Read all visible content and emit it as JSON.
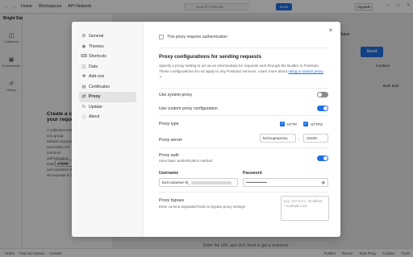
{
  "topbar": {
    "nav_home": "Home",
    "nav_workspaces": "Workspaces",
    "nav_api_network": "API Network",
    "search_placeholder": "Search Postman",
    "invite_label": "Invite",
    "upgrade_label": "Upgrade"
  },
  "workspace": {
    "name": "Bright Data"
  },
  "leftbar": {
    "items": [
      {
        "label": "Collections",
        "icon": "folder-icon"
      },
      {
        "label": "Environments",
        "icon": "environment-icon"
      },
      {
        "label": "History",
        "icon": "history-icon"
      }
    ]
  },
  "sidepanel": {
    "title": "Create a collection for your requests",
    "description": "A collection lets you group related requests and easily set common authorization, tests, scripts, and variables for all requests in it.",
    "create_button": "Create"
  },
  "request": {
    "send_label": "Send",
    "save_label": "Save",
    "cookies_label": "Cookies",
    "bulk_edit_label": "Bulk Edit",
    "hint": "Enter the URL and click Send to get a response"
  },
  "statusbar": {
    "online": "Online",
    "find_replace": "Find and replace",
    "console": "Console",
    "postbot": "Postbot",
    "runner": "Runner",
    "start_proxy": "Start Proxy",
    "cookies": "Cookies",
    "trash": "Trash"
  },
  "settings": {
    "nav": [
      {
        "label": "General",
        "icon": "gear-icon",
        "active": false
      },
      {
        "label": "Themes",
        "icon": "palette-icon",
        "active": false
      },
      {
        "label": "Shortcuts",
        "icon": "keyboard-icon",
        "active": false
      },
      {
        "label": "Data",
        "icon": "database-icon",
        "active": false
      },
      {
        "label": "Add-ons",
        "icon": "puzzle-icon",
        "active": false
      },
      {
        "label": "Certificates",
        "icon": "certificate-icon",
        "active": false
      },
      {
        "label": "Proxy",
        "icon": "proxy-icon",
        "active": true
      },
      {
        "label": "Update",
        "icon": "update-icon",
        "active": false
      },
      {
        "label": "About",
        "icon": "info-icon",
        "active": false
      }
    ],
    "proxy": {
      "requires_auth_label": "This proxy requires authentication",
      "section_title": "Proxy configurations for sending requests",
      "section_desc": "Specify a proxy setting to act as an intermediary for requests sent through the Builder in Postman. These configurations do not apply to any Postman services. Learn more about",
      "section_link": "using a custom proxy",
      "use_system_proxy_label": "Use system proxy",
      "use_system_proxy_on": false,
      "use_custom_proxy_label": "Use custom proxy configuration",
      "use_custom_proxy_on": true,
      "proxy_type_label": "Proxy type",
      "http_label": "HTTP",
      "https_label": "HTTPS",
      "proxy_server_label": "Proxy server",
      "proxy_server_value": "brd.superproxy",
      "proxy_port_value": "22225",
      "proxy_auth_label": "Proxy auth",
      "proxy_auth_desc": "Uses basic authentication method.",
      "proxy_auth_on": true,
      "username_label": "Username",
      "username_value": "brd-customer-hl_",
      "password_label": "Password",
      "password_value": "••••••••••••••••",
      "bypass_label": "Proxy bypass",
      "bypass_desc": "Enter comma separated hosts to bypass proxy settings",
      "bypass_placeholder": "E.g. 127.0.0.1, localhost, *.example.com"
    }
  },
  "colors": {
    "accent": "#1f6fe6",
    "toggle_off": "#8a8a8a",
    "nav_active": "#e4e4e4"
  }
}
